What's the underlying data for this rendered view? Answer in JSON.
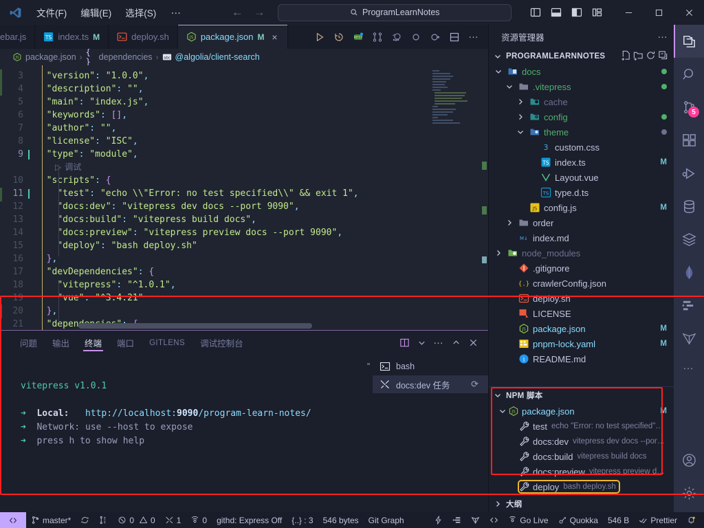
{
  "titlebar": {
    "menus": [
      "文件(F)",
      "编辑(E)",
      "选择(S)"
    ],
    "overflow": "…",
    "back_icon": "arrow-left-icon",
    "forward_icon": "arrow-right-icon",
    "search_value": "ProgramLearnNotes",
    "search_icon": "search-icon",
    "layout_icons": [
      "toggle-primary-sidebar-icon",
      "toggle-panel-icon",
      "toggle-secondary-sidebar-icon",
      "customize-layout-icon"
    ],
    "window_controls": [
      "minimize-icon",
      "maximize-icon",
      "close-icon"
    ]
  },
  "tabs": [
    {
      "label": "ebar.js",
      "icon": "js-file-icon",
      "modified": "",
      "active": false,
      "truncated": true
    },
    {
      "label": "index.ts",
      "icon": "ts-file-icon",
      "modified": "M",
      "active": false
    },
    {
      "label": "deploy.sh",
      "icon": "shell-file-icon",
      "modified": "",
      "active": false
    },
    {
      "label": "package.json",
      "icon": "nodejs-file-icon",
      "modified": "M",
      "active": true,
      "close": "×"
    }
  ],
  "editor_actions": [
    "run-icon",
    "timeline-icon",
    "restclient-icon",
    "compare-changes-icon",
    "git-lens-icon",
    "circle-icon",
    "circle-arrow-icon",
    "split-editor-icon",
    "more-actions-icon"
  ],
  "breadcrumb": [
    {
      "label": "package.json",
      "icon": "nodejs-file-icon"
    },
    {
      "label": "dependencies",
      "icon": "braces-icon"
    },
    {
      "label": "@algolia/client-search",
      "icon": "abc-icon"
    }
  ],
  "code": {
    "lines": [
      {
        "num": "3",
        "html": "  <span class='s'>\"version\"</span><span class='p'>:</span> <span class='s'>\"1.0.0\"</span><span class='p'>,</span>"
      },
      {
        "num": "4",
        "html": "  <span class='s'>\"description\"</span><span class='p'>:</span> <span class='s'>\"\"</span><span class='p'>,</span>"
      },
      {
        "num": "5",
        "html": "  <span class='s'>\"main\"</span><span class='p'>:</span> <span class='s'>\"index.js\"</span><span class='p'>,</span>"
      },
      {
        "num": "6",
        "html": "  <span class='s'>\"keywords\"</span><span class='p'>:</span> <span class='br'>[]</span><span class='p'>,</span>"
      },
      {
        "num": "7",
        "html": "  <span class='s'>\"author\"</span><span class='p'>:</span> <span class='s'>\"\"</span><span class='p'>,</span>"
      },
      {
        "num": "8",
        "html": "  <span class='s'>\"license\"</span><span class='p'>:</span> <span class='s'>\"ISC\"</span><span class='p'>,</span>"
      },
      {
        "num": "9",
        "html": "  <span class='s'>\"type\"</span><span class='p'>:</span> <span class='s'>\"module\"</span><span class='p'>,</span>",
        "cursor": true
      },
      {
        "num": "10",
        "html": "  <span class='s'>\"scripts\"</span><span class='p'>:</span> <span class='br'>{</span>"
      },
      {
        "num": "11",
        "html": "    <span class='s'>\"test\"</span><span class='p'>:</span> <span class='s'>\"echo \\\\\"Error: no test specified\\\\\" &amp;&amp; exit 1\"</span><span class='p'>,</span>",
        "cursor": true
      },
      {
        "num": "12",
        "html": "    <span class='s'>\"docs:dev\"</span><span class='p'>:</span> <span class='s'>\"vitepress dev docs --port 9090\"</span><span class='p'>,</span>"
      },
      {
        "num": "13",
        "html": "    <span class='s'>\"docs:build\"</span><span class='p'>:</span> <span class='s'>\"vitepress build docs\"</span><span class='p'>,</span>"
      },
      {
        "num": "14",
        "html": "    <span class='s'>\"docs:preview\"</span><span class='p'>:</span> <span class='s'>\"vitepress preview docs --port 9090\"</span><span class='p'>,</span>"
      },
      {
        "num": "15",
        "html": "    <span class='s'>\"deploy\"</span><span class='p'>:</span> <span class='s'>\"bash deploy.sh\"</span>"
      },
      {
        "num": "16",
        "html": "  <span class='br'>}</span><span class='p'>,</span>"
      },
      {
        "num": "17",
        "html": "  <span class='s'>\"devDependencies\"</span><span class='p'>:</span> <span class='br'>{</span>"
      },
      {
        "num": "18",
        "html": "    <span class='s'>\"vitepress\"</span><span class='p'>:</span> <span class='s'>\"^1.0.1\"</span><span class='p'>,</span>"
      },
      {
        "num": "19",
        "html": "    <span class='s'>\"vue\"</span><span class='p'>:</span> <span class='s'>\"^3.4.21\"</span>"
      },
      {
        "num": "20",
        "html": "  <span class='br'>}</span><span class='p'>,</span>"
      },
      {
        "num": "21",
        "html": "  <span class='s'>\"dependencies\"</span><span class='p'>:</span> <span class='br'>{</span>"
      }
    ],
    "codelens": "调试",
    "codelens_icon": "play-icon"
  },
  "panel": {
    "tabs": [
      "问题",
      "输出",
      "终端",
      "端口",
      "GITLENS",
      "调试控制台"
    ],
    "active_tab": "终端",
    "actions": [
      "split-terminal-icon",
      "chevron-down-icon",
      "more-actions-icon",
      "chevron-up-icon",
      "close-icon"
    ],
    "terminal_output": {
      "version": "vitepress v1.0.1",
      "local_label": "Local:",
      "local_url_prefix": "http://localhost:",
      "local_port": "9090",
      "local_url_suffix": "/program-learn-notes/",
      "network_label": "Network:",
      "network_value": "use --host to expose",
      "help_line": "press h to show help"
    },
    "terminals": [
      {
        "label": "bash",
        "icon": "shell-icon",
        "selected": false
      },
      {
        "label": "docs:dev 任务",
        "icon": "tools-icon",
        "selected": true,
        "spinner": "spinner-icon"
      }
    ]
  },
  "sidebar": {
    "title": "资源管理器",
    "title_dots": "…",
    "project": {
      "name": "PROGRAMLEARNNOTES",
      "actions": [
        "new-file-icon",
        "new-folder-icon",
        "refresh-icon",
        "collapse-all-icon"
      ]
    },
    "tree": [
      {
        "label": "docs",
        "icon": "folder-docs-icon",
        "indent": 1,
        "expanded": true,
        "dot": "#4fb06d"
      },
      {
        "label": ".vitepress",
        "icon": "folder-icon",
        "indent": 2,
        "expanded": true,
        "dot": "#4fb06d"
      },
      {
        "label": "cache",
        "icon": "folder-cache-icon",
        "indent": 3,
        "expanded": false,
        "dim": true
      },
      {
        "label": "config",
        "icon": "folder-config-icon",
        "indent": 3,
        "expanded": false,
        "dot": "#4fb06d"
      },
      {
        "label": "theme",
        "icon": "folder-theme-icon",
        "indent": 3,
        "expanded": true,
        "dot": "#6b7190"
      },
      {
        "label": "custom.css",
        "icon": "css-file-icon",
        "indent": 4
      },
      {
        "label": "index.ts",
        "icon": "ts-file-icon",
        "indent": 4,
        "badge": "M"
      },
      {
        "label": "Layout.vue",
        "icon": "vue-file-icon",
        "indent": 4
      },
      {
        "label": "type.d.ts",
        "icon": "ts-def-file-icon",
        "indent": 4
      },
      {
        "label": "config.js",
        "icon": "js-file-icon",
        "indent": 3,
        "badge": "M"
      },
      {
        "label": "order",
        "icon": "folder-icon",
        "indent": 2,
        "expanded": false
      },
      {
        "label": "index.md",
        "icon": "markdown-file-icon",
        "indent": 2
      },
      {
        "label": "node_modules",
        "icon": "folder-node-icon",
        "indent": 1,
        "expanded": false,
        "dim": true
      },
      {
        "label": ".gitignore",
        "icon": "git-file-icon",
        "indent": 2
      },
      {
        "label": "crawlerConfig.json",
        "icon": "json-file-icon",
        "indent": 2
      },
      {
        "label": "deploy.sh",
        "icon": "shell-file-icon",
        "indent": 2
      },
      {
        "label": "LICENSE",
        "icon": "license-file-icon",
        "indent": 2
      },
      {
        "label": "package.json",
        "icon": "nodejs-file-icon",
        "indent": 2,
        "badge": "M",
        "cyan": true
      },
      {
        "label": "pnpm-lock.yaml",
        "icon": "yaml-file-icon",
        "indent": 2,
        "badge": "M",
        "cyan": true
      },
      {
        "label": "README.md",
        "icon": "info-file-icon",
        "indent": 2
      }
    ],
    "npm": {
      "title": "NPM 脚本",
      "package": {
        "label": "package.json",
        "icon": "nodejs-file-icon",
        "badge": "M"
      },
      "scripts": [
        {
          "name": "test",
          "cmd": "echo \"Error: no test specified\"…",
          "icon": "wrench-icon"
        },
        {
          "name": "docs:dev",
          "cmd": "vitepress dev docs --por…",
          "icon": "wrench-icon"
        },
        {
          "name": "docs:build",
          "cmd": "vitepress build docs",
          "icon": "wrench-icon"
        },
        {
          "name": "docs:preview",
          "cmd": "vitepress preview d…",
          "icon": "wrench-icon"
        },
        {
          "name": "deploy",
          "cmd": "bash deploy.sh",
          "icon": "wrench-icon",
          "highlighted": true
        }
      ]
    },
    "outline": {
      "title": "大纲"
    }
  },
  "activitybar": {
    "items": [
      {
        "name": "explorer-icon",
        "active": true
      },
      {
        "name": "search-icon",
        "active": false
      },
      {
        "name": "source-control-icon",
        "active": false,
        "badge": "5"
      },
      {
        "name": "extensions-icon",
        "active": false
      },
      {
        "name": "run-and-debug-icon",
        "active": false
      },
      {
        "name": "database-icon",
        "active": false
      },
      {
        "name": "layers-icon",
        "active": false
      },
      {
        "name": "mongodb-icon",
        "active": false
      },
      {
        "name": "todo-tree-icon",
        "active": false
      },
      {
        "name": "vite-icon",
        "active": false
      },
      {
        "name": "more-views-icon",
        "active": false,
        "dots": "…"
      }
    ],
    "bottom": [
      {
        "name": "accounts-icon"
      },
      {
        "name": "settings-gear-icon"
      }
    ]
  },
  "statusbar": {
    "remote_icon": "remote-window-icon",
    "left": [
      {
        "icon": "source-control-icon",
        "label": "master*",
        "name": "branch-status"
      },
      {
        "icon": "sync-icon",
        "label": "",
        "name": "sync-status"
      },
      {
        "icon": "git-graph-icon",
        "label": "",
        "name": "git-action-status"
      },
      {
        "icon": "error-icon",
        "label": "0",
        "icon2": "warning-icon",
        "label2": "0",
        "name": "problems-status"
      },
      {
        "icon": "ports-icon",
        "label": "1",
        "name": "ports-status"
      },
      {
        "icon": "radio-tower-icon",
        "label": "0",
        "name": "live-share-status"
      },
      {
        "icon": "",
        "label": "githd: Express Off",
        "name": "githd-status"
      },
      {
        "icon": "",
        "label": "{..} : 3",
        "name": "json-path-status"
      },
      {
        "icon": "",
        "label": "546 bytes",
        "name": "file-size-status"
      },
      {
        "icon": "",
        "label": "Git Graph",
        "name": "git-graph-status"
      }
    ],
    "right": [
      {
        "icon": "thunder-icon",
        "label": "",
        "name": "thunder-client-status"
      },
      {
        "icon": "indent-icon",
        "label": "",
        "name": "indent-status"
      },
      {
        "icon": "vite-icon",
        "label": "",
        "name": "vite-status"
      },
      {
        "icon": "codesnap-icon",
        "label": "",
        "name": "codesnap-status"
      },
      {
        "icon": "broadcast-icon",
        "label": "Go Live",
        "name": "go-live-status"
      },
      {
        "icon": "quokka-icon",
        "label": "Quokka",
        "name": "quokka-status"
      },
      {
        "icon": "",
        "label": "546 B",
        "name": "size-status"
      },
      {
        "icon": "check-all-icon",
        "label": "Prettier",
        "name": "prettier-status"
      },
      {
        "icon": "bell-dot-icon",
        "label": "",
        "name": "notifications-status"
      }
    ]
  }
}
